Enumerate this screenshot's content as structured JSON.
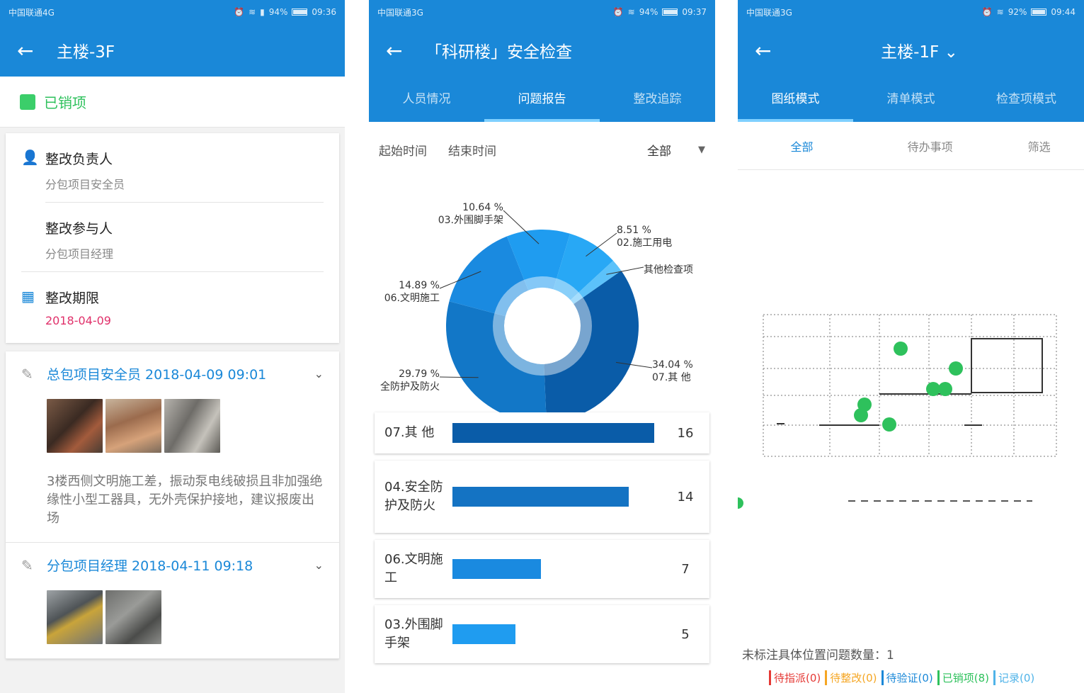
{
  "status_bar": {
    "p1": {
      "carrier": "中国联通4G",
      "battery": "94%",
      "time": "09:36"
    },
    "p2": {
      "carrier": "中国联通3G",
      "battery": "94%",
      "time": "09:37"
    },
    "p3": {
      "carrier": "中国联通3G",
      "battery": "92%",
      "time": "09:44"
    }
  },
  "p1": {
    "title": "主楼-3F",
    "status_label": "已销项",
    "responsible_label": "整改负责人",
    "responsible_value": "分包项目安全员",
    "participant_label": "整改参与人",
    "participant_value": "分包项目经理",
    "deadline_label": "整改期限",
    "deadline_value": "2018-04-09",
    "logs": [
      {
        "header": "总包项目安全员 2018-04-09 09:01",
        "text": "3楼西侧文明施工差，振动泵电线破损且非加强绝缘性小型工器具，无外壳保护接地，建议报废出场"
      },
      {
        "header": "分包项目经理 2018-04-11 09:18"
      }
    ]
  },
  "p2": {
    "title": "「科研楼」安全检查",
    "tabs": [
      "人员情况",
      "问题报告",
      "整改追踪"
    ],
    "filter_start": "起始时间",
    "filter_end": "结束时间",
    "filter_select": "全部"
  },
  "chart_data": {
    "type": "pie",
    "slices": [
      {
        "pct": "34.04 %",
        "label": "07.其 他",
        "value": 34.04,
        "color": "#0a5ca8"
      },
      {
        "pct": "29.79 %",
        "label": "全防护及防火",
        "value": 29.79,
        "color": "#1277c7"
      },
      {
        "pct": "14.89 %",
        "label": "06.文明施工",
        "value": 14.89,
        "color": "#1a8ae0"
      },
      {
        "pct": "10.64 %",
        "label": "03.外围脚手架",
        "value": 10.64,
        "color": "#1f9cf0"
      },
      {
        "pct": "8.51 %",
        "label": "02.施工用电",
        "value": 8.51,
        "color": "#28a8f5"
      },
      {
        "label": "其他检查项",
        "value": 2.13,
        "color": "#5cc2fa"
      }
    ],
    "bars": [
      {
        "label": "07.其 他",
        "value": 16,
        "color": "#0a5ca8"
      },
      {
        "label": "04.安全防护及防火",
        "value": 14,
        "color": "#1473c3"
      },
      {
        "label": "06.文明施工",
        "value": 7,
        "color": "#1a8ae0"
      },
      {
        "label": "03.外围脚手架",
        "value": 5,
        "color": "#1f9cf0"
      }
    ],
    "bar_max": 16
  },
  "p3": {
    "title": "主楼-1F",
    "tabs": [
      "图纸模式",
      "清单模式",
      "检查项模式"
    ],
    "subtabs": [
      "全部",
      "待办事项",
      "筛选"
    ],
    "unmarked": "未标注具体位置问题数量：1",
    "legend": [
      {
        "text": "待指派(0)",
        "color": "#e53935"
      },
      {
        "text": "待整改(0)",
        "color": "#f5a623"
      },
      {
        "text": "待验证(0)",
        "color": "#1a88d8"
      },
      {
        "text": "已销项(8)",
        "color": "#2ec15c"
      },
      {
        "text": "记录(0)",
        "color": "#4fb3e8"
      }
    ]
  }
}
